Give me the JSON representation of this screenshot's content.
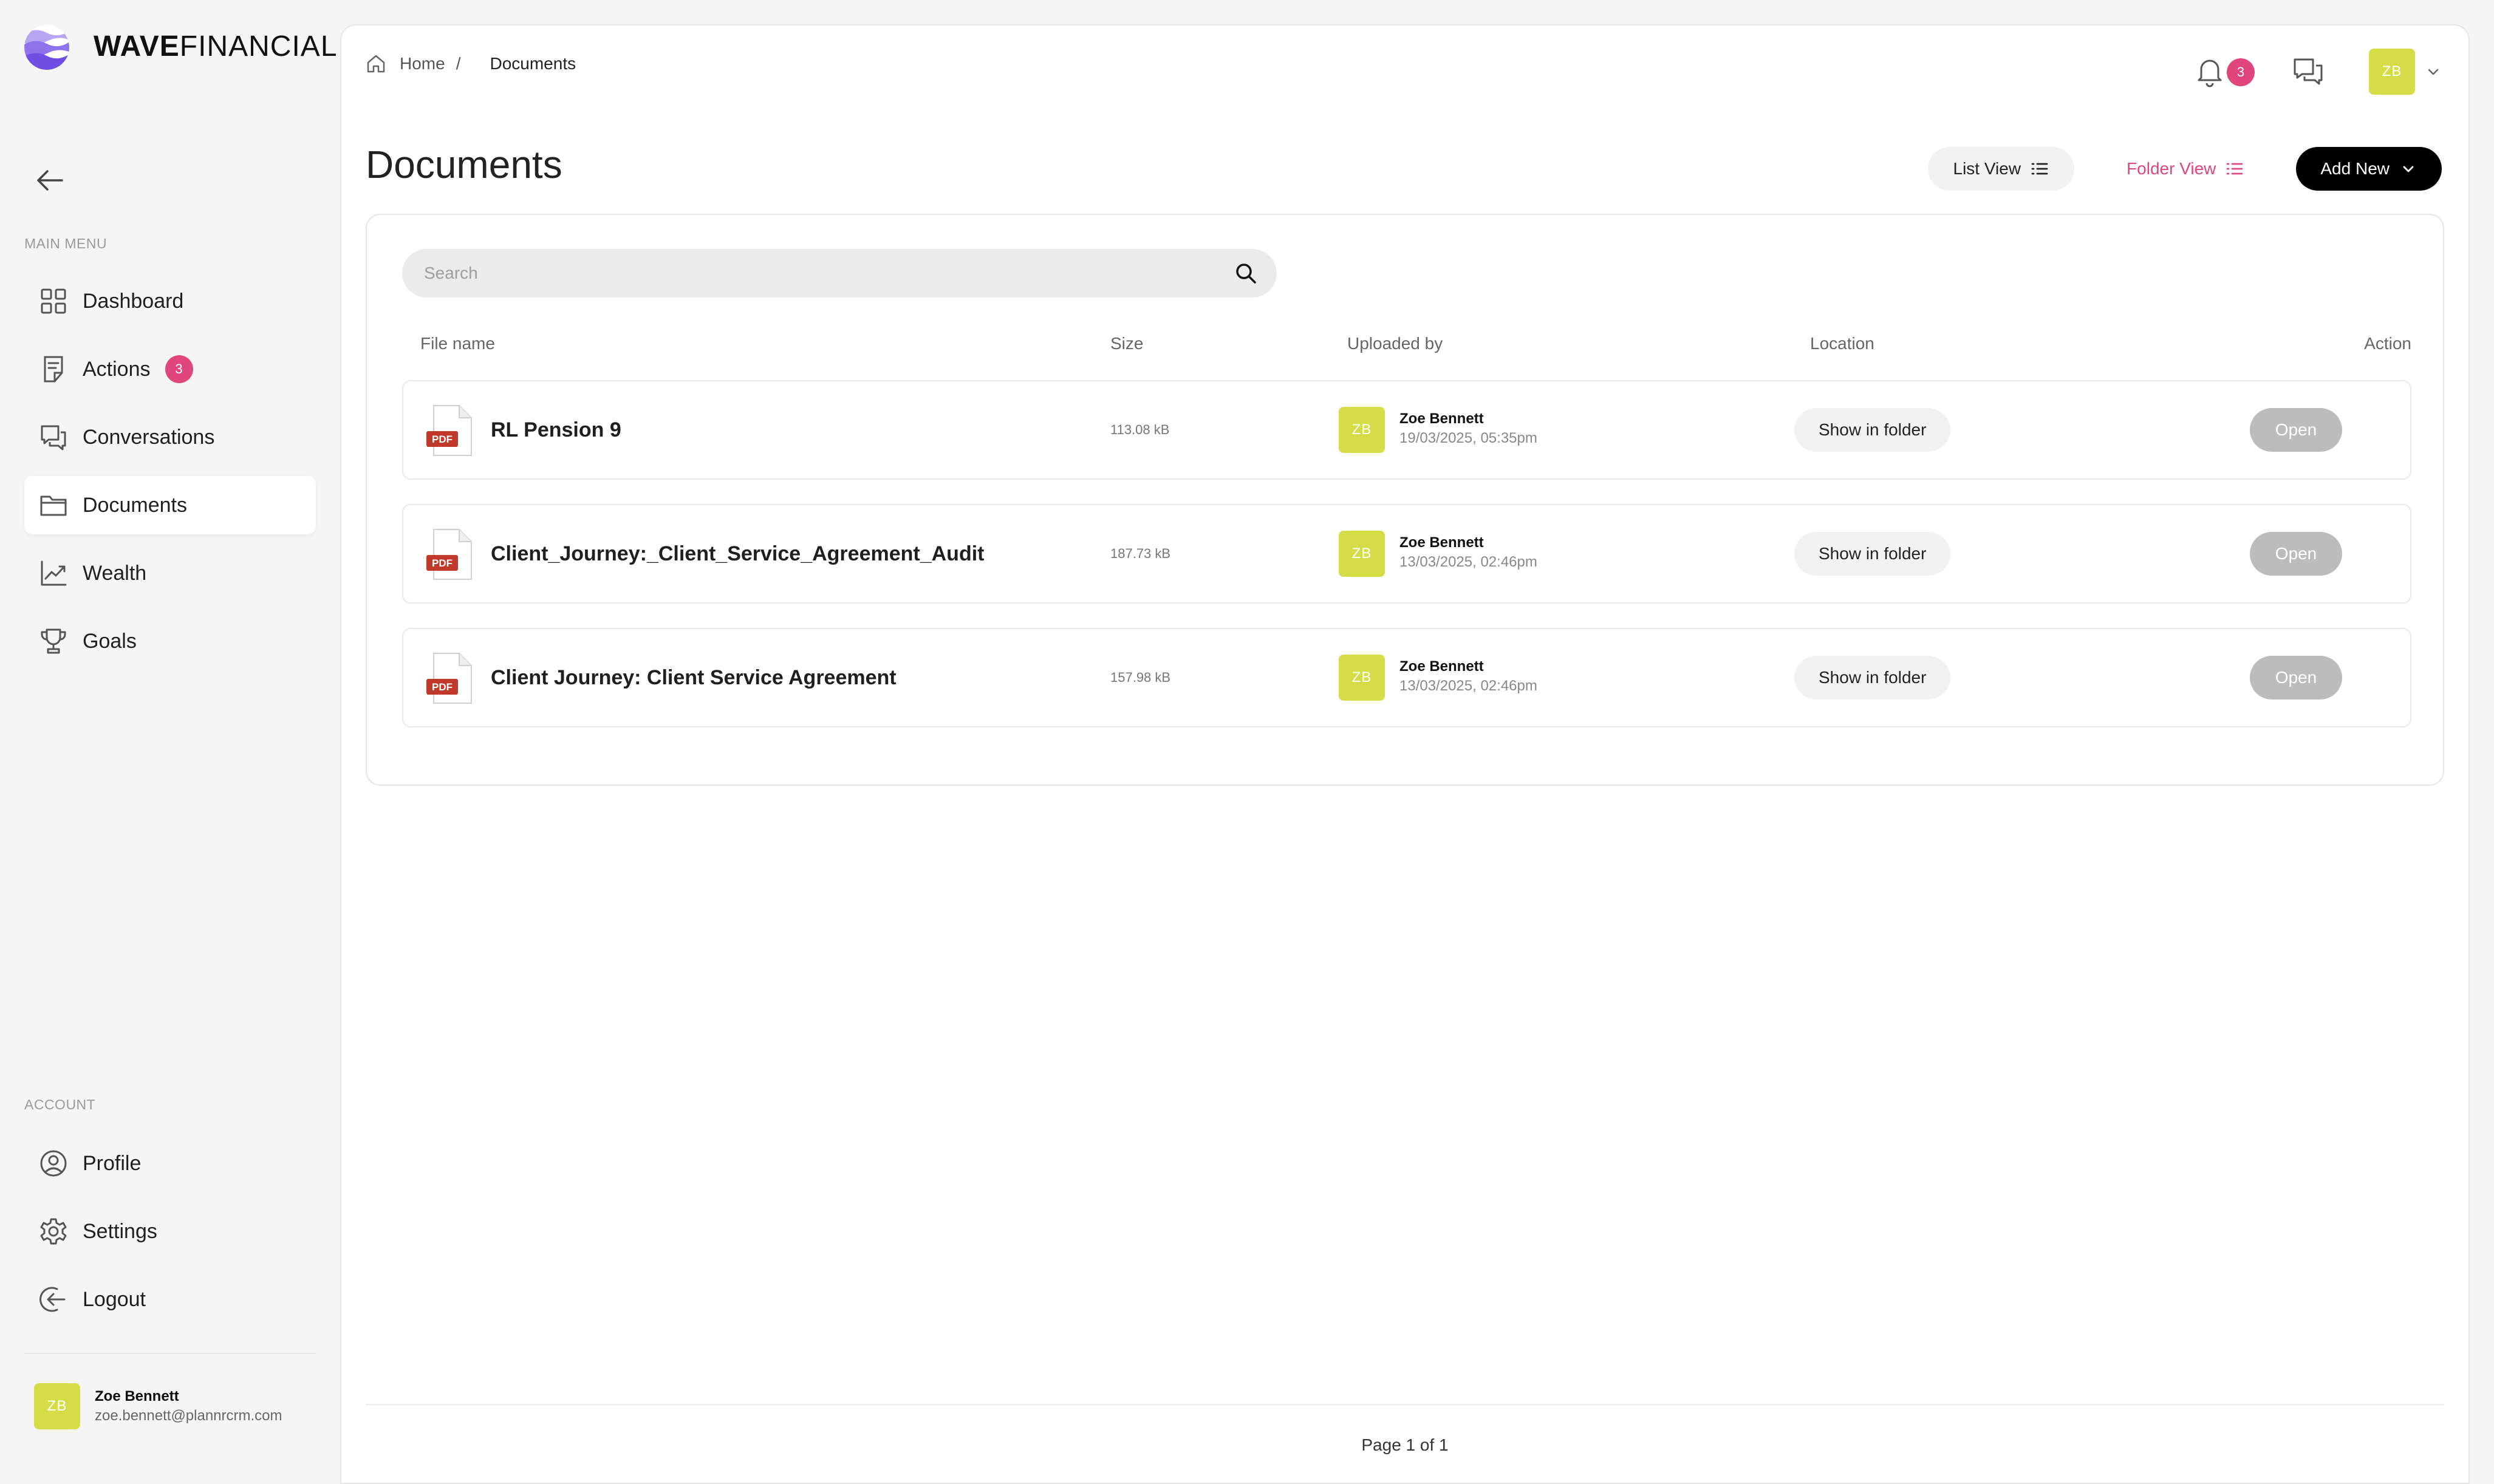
{
  "brand": {
    "bold": "WAVE",
    "light": "FINANCIAL",
    "accent": "#e0457b",
    "avatar_color": "#d4dd46"
  },
  "sidebar": {
    "main_menu_label": "MAIN MENU",
    "account_label": "ACCOUNT",
    "main_items": [
      {
        "label": "Dashboard",
        "icon": "grid-icon"
      },
      {
        "label": "Actions",
        "icon": "clipboard-icon",
        "badge": "3"
      },
      {
        "label": "Conversations",
        "icon": "chat-icon"
      },
      {
        "label": "Documents",
        "icon": "folder-icon",
        "active": true
      },
      {
        "label": "Wealth",
        "icon": "chart-up-icon"
      },
      {
        "label": "Goals",
        "icon": "trophy-icon"
      }
    ],
    "account_items": [
      {
        "label": "Profile",
        "icon": "user-circle-icon"
      },
      {
        "label": "Settings",
        "icon": "gear-icon"
      },
      {
        "label": "Logout",
        "icon": "logout-icon"
      }
    ],
    "user": {
      "initials": "ZB",
      "name": "Zoe Bennett",
      "email": "zoe.bennett@plannrcrm.com"
    }
  },
  "header": {
    "breadcrumb": {
      "home": "Home",
      "separator": "/",
      "current": "Documents"
    },
    "notification_count": "3",
    "avatar_initials": "ZB"
  },
  "page": {
    "title": "Documents",
    "list_view_label": "List View",
    "folder_view_label": "Folder View",
    "add_new_label": "Add New"
  },
  "search": {
    "placeholder": "Search",
    "value": ""
  },
  "table": {
    "columns": {
      "file_name": "File name",
      "size": "Size",
      "uploaded_by": "Uploaded by",
      "location": "Location",
      "action": "Action"
    },
    "rows": [
      {
        "name": "RL Pension 9",
        "type": "PDF",
        "size": "113.08 kB",
        "uploader": "Zoe Bennett",
        "initials": "ZB",
        "date": "19/03/2025, 05:35pm",
        "location_label": "Show in folder",
        "action_label": "Open"
      },
      {
        "name": "Client_Journey:_Client_Service_Agreement_Audit",
        "type": "PDF",
        "size": "187.73 kB",
        "uploader": "Zoe Bennett",
        "initials": "ZB",
        "date": "13/03/2025, 02:46pm",
        "location_label": "Show in folder",
        "action_label": "Open"
      },
      {
        "name": "Client Journey: Client Service Agreement",
        "type": "PDF",
        "size": "157.98 kB",
        "uploader": "Zoe Bennett",
        "initials": "ZB",
        "date": "13/03/2025, 02:46pm",
        "location_label": "Show in folder",
        "action_label": "Open"
      }
    ]
  },
  "pagination": {
    "text": "Page 1 of 1"
  }
}
